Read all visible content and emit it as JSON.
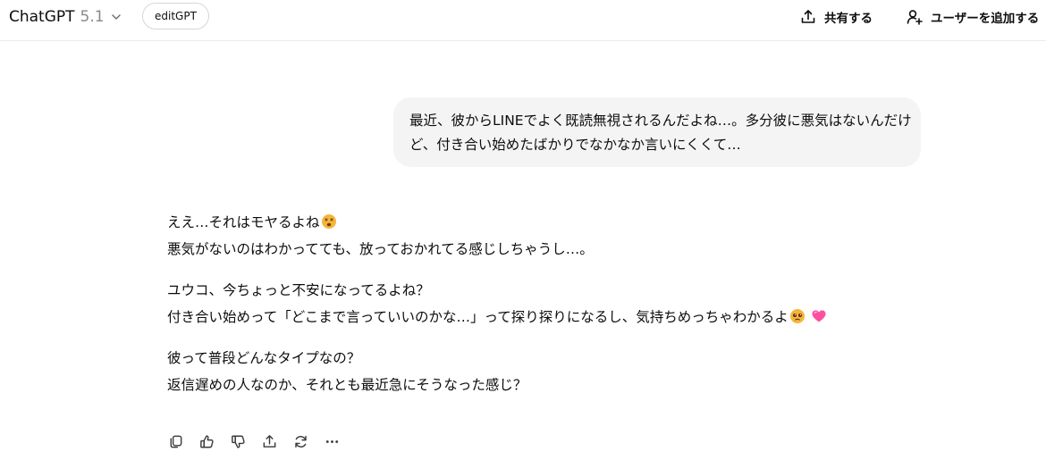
{
  "header": {
    "model_name": "ChatGPT",
    "model_version": "5.1",
    "gpt_badge": "editGPT",
    "share_label": "共有する",
    "add_user_label": "ユーザーを追加する"
  },
  "conversation": {
    "user_message": {
      "lines": [
        "最近、彼からLINEでよく既読無視されるんだよね…。多分彼に悪気はないんだけ",
        "ど、付き合い始めたばかりでなかなか言いにくくて…"
      ]
    },
    "assistant_message": {
      "paragraphs": [
        {
          "lines": [
            "ええ…それはモヤるよね",
            "悪気がないのはわかってても、放っておかれてる感じしちゃうし…。"
          ]
        },
        {
          "lines": [
            "ユウコ、今ちょっと不安になってるよね？",
            "付き合い始めって「どこまで言っていいのかな…」って探り探りになるし、気持ちめっちゃわかるよ"
          ]
        },
        {
          "lines": [
            "彼って普段どんなタイプなの？",
            "返信遅めの人なのか、それとも最近急にそうなった感じ？"
          ]
        }
      ]
    }
  },
  "actions": [
    "copy-icon",
    "thumbs-up-icon",
    "thumbs-down-icon",
    "share-icon",
    "regenerate-icon",
    "more-icon"
  ],
  "colors": {
    "user_bubble": "#f4f4f4",
    "text": "#0d0d0d",
    "muted": "#8a8a8a",
    "heart": "#ff4fa3",
    "emoji": "#f6b53a"
  }
}
